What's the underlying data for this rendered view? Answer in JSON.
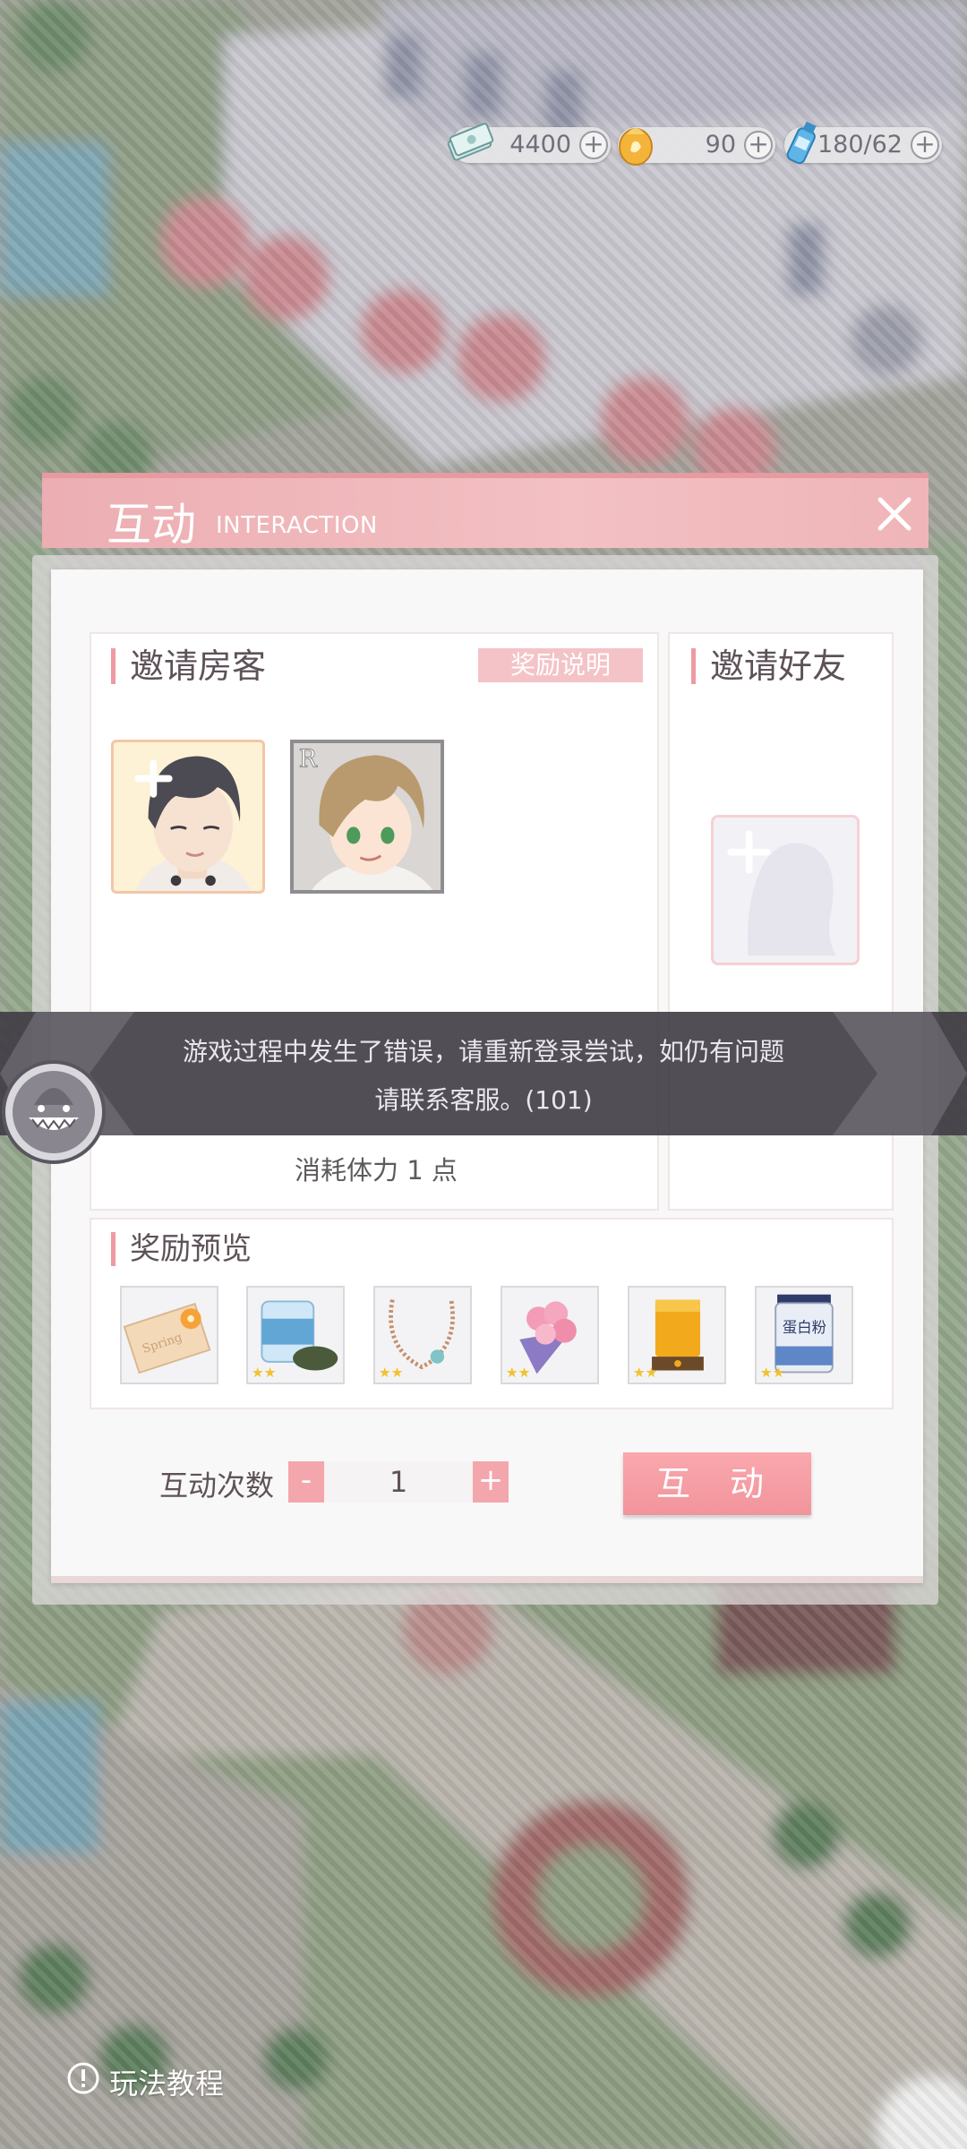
{
  "currencies": [
    {
      "name": "bills",
      "value": "4400"
    },
    {
      "name": "stamina",
      "value": "90"
    },
    {
      "name": "water",
      "value": "180/62"
    }
  ],
  "panel": {
    "title": "互动",
    "subtitle": "INTERACTION"
  },
  "invite_guests": {
    "title": "邀请房客",
    "reward_info_label": "奖励说明",
    "guests": [
      {
        "slot": "add",
        "portrait": "dark-haired-man-portrait"
      },
      {
        "slot": "occupied",
        "rarity": "R",
        "portrait": "blond-young-man-portrait"
      }
    ],
    "stamina_cost_text": "消耗体力 1 点"
  },
  "invite_friends": {
    "title": "邀请好友",
    "slot": "empty-add"
  },
  "rewards": {
    "title": "奖励预览",
    "items": [
      {
        "icon": "flower-postcard-icon",
        "stars": 0
      },
      {
        "icon": "seaweed-jar-icon",
        "stars": 2
      },
      {
        "icon": "necklace-icon",
        "stars": 2
      },
      {
        "icon": "flower-bouquet-icon",
        "stars": 2
      },
      {
        "icon": "honey-candle-icon",
        "stars": 2
      },
      {
        "icon": "protein-powder-icon",
        "stars": 2,
        "label": "蛋白粉"
      }
    ]
  },
  "interaction_count": {
    "label": "互动次数",
    "minus": "-",
    "plus": "+",
    "value": "1"
  },
  "interact_button_label": "互 动",
  "error_toast": {
    "line1": "游戏过程中发生了错误，请重新登录尝试，如仍有问题",
    "line2": "请联系客服。(101)"
  },
  "tutorial_label": "玩法教程",
  "colors": {
    "accent_pink": "#f4a6ad",
    "header_pink": "#f3c0c3",
    "toast_dark": "#3f3b44"
  }
}
